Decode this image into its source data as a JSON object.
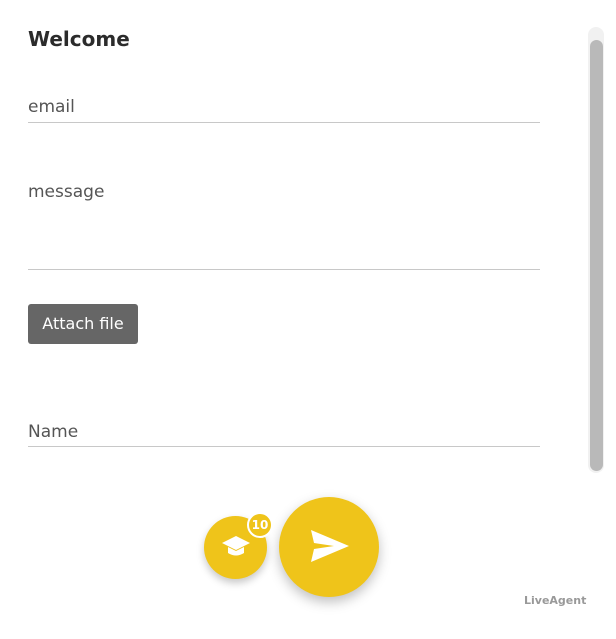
{
  "form": {
    "title": "Welcome",
    "fields": {
      "email": {
        "placeholder": "email"
      },
      "message": {
        "placeholder": "message"
      },
      "name": {
        "placeholder": "Name"
      }
    },
    "attach_label": "Attach file"
  },
  "actions": {
    "knowledge_button": {
      "icon": "graduation-cap-icon",
      "badge_count": "10"
    },
    "send_button": {
      "icon": "send-icon"
    }
  },
  "footer": {
    "brand": "LiveAgent"
  },
  "colors": {
    "accent": "#efc41a",
    "button_gray": "#666666",
    "text": "#2b2b2b",
    "muted": "#555555",
    "brand_text": "#999999"
  }
}
